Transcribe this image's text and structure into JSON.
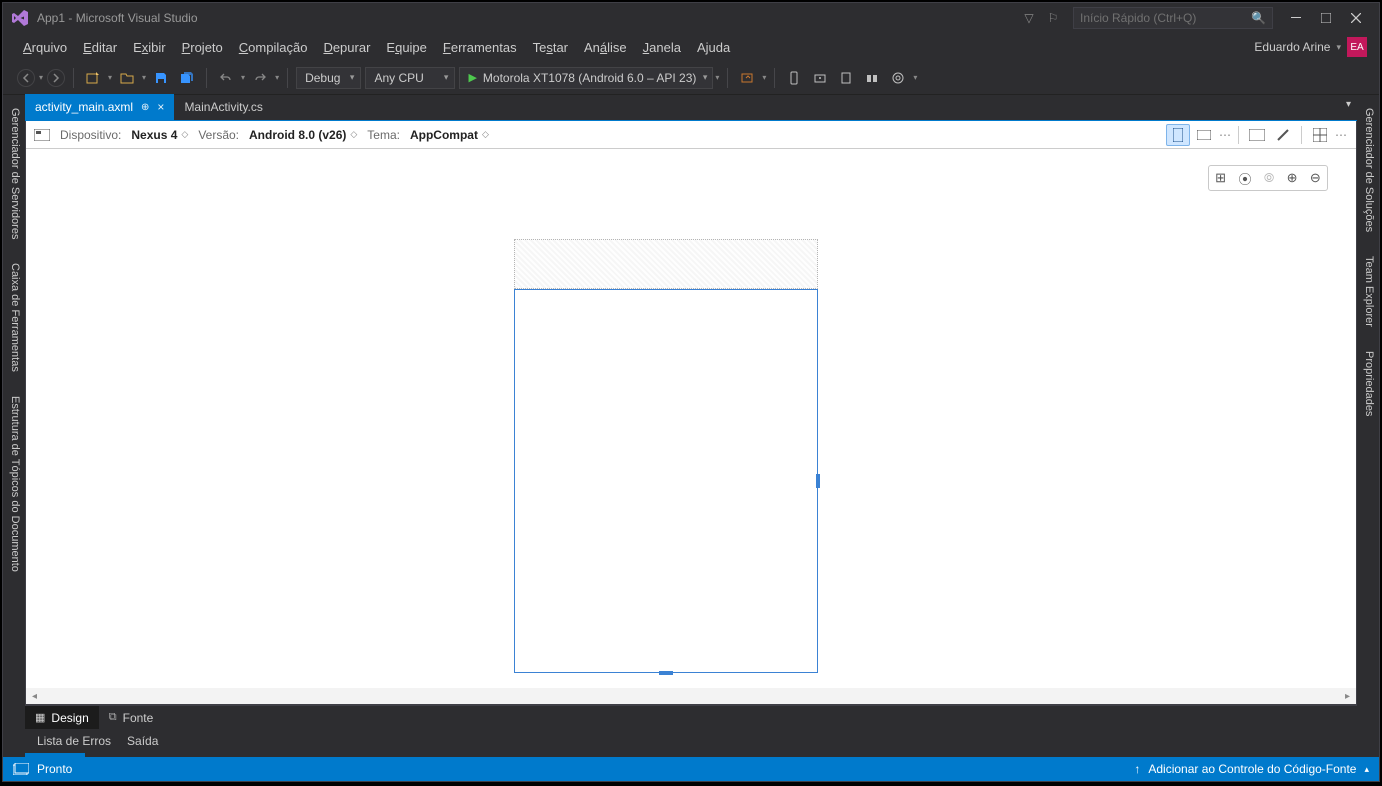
{
  "title": "App1 - Microsoft Visual Studio",
  "quick_launch_placeholder": "Início Rápido (Ctrl+Q)",
  "menus": [
    "Arquivo",
    "Editar",
    "Exibir",
    "Projeto",
    "Compilação",
    "Depurar",
    "Equipe",
    "Ferramentas",
    "Testar",
    "Análise",
    "Janela",
    "Ajuda"
  ],
  "menu_underline_index": [
    0,
    0,
    1,
    0,
    0,
    0,
    1,
    0,
    2,
    2,
    0,
    1
  ],
  "user": {
    "name": "Eduardo Arine",
    "initials": "EA"
  },
  "toolbar": {
    "config": "Debug",
    "platform": "Any CPU",
    "target": "Motorola XT1078 (Android 6.0 – API 23)"
  },
  "tabs": [
    {
      "name": "activity_main.axml",
      "active": true,
      "pinned": true
    },
    {
      "name": "MainActivity.cs",
      "active": false,
      "pinned": false
    }
  ],
  "designer": {
    "device_label": "Dispositivo:",
    "device_value": "Nexus 4",
    "version_label": "Versão:",
    "version_value": "Android 8.0 (v26)",
    "theme_label": "Tema:",
    "theme_value": "AppCompat"
  },
  "designer_tabs": {
    "design": "Design",
    "source": "Fonte"
  },
  "panel_tabs": [
    "Lista de Erros",
    "Saída"
  ],
  "left_rails": [
    "Gerenciador de Servidores",
    "Caixa de Ferramentas",
    "Estrutura de Tópicos do Documento"
  ],
  "right_rails": [
    "Gerenciador de Soluções",
    "Team Explorer",
    "Propriedades"
  ],
  "status": {
    "ready": "Pronto",
    "source_control": "Adicionar ao Controle do Código-Fonte"
  }
}
